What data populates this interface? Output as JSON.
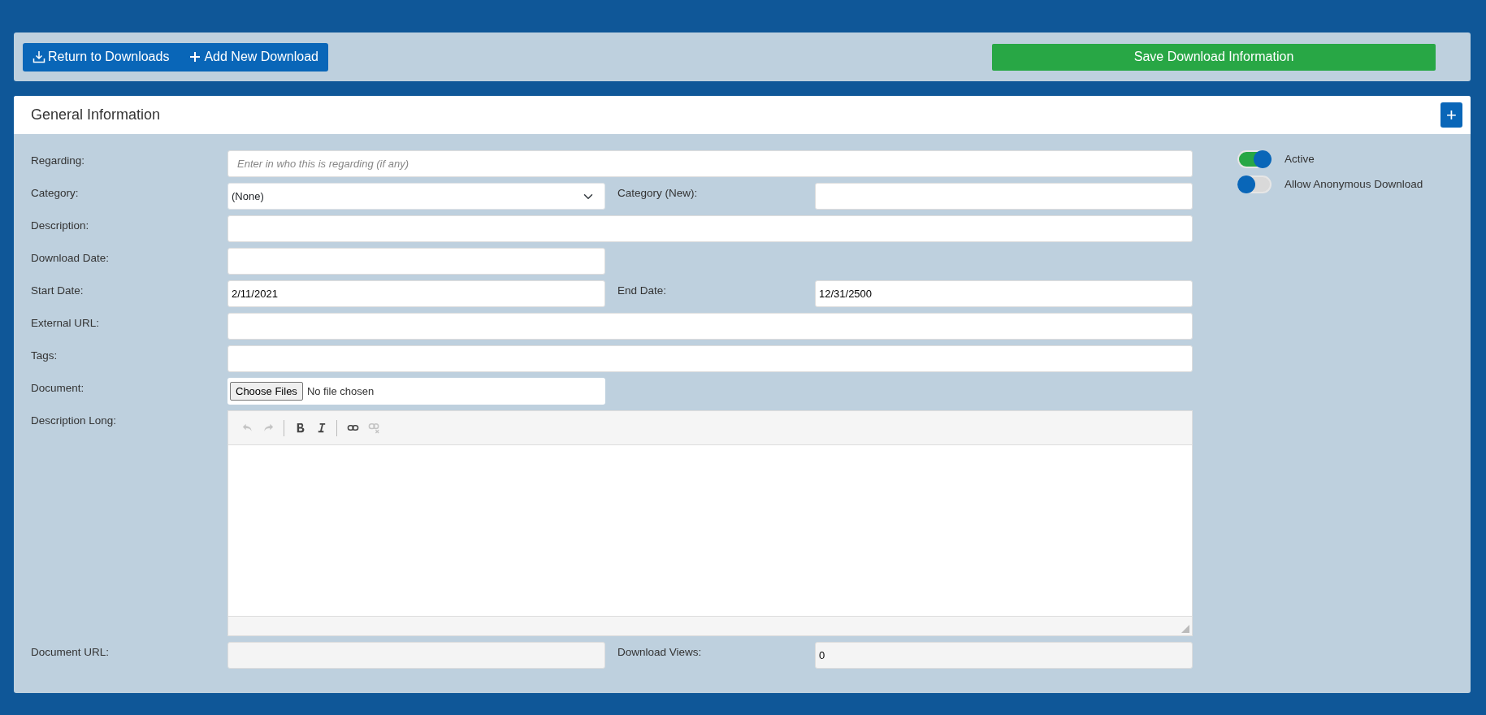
{
  "toolbar": {
    "buttons": [
      {
        "kind": "download",
        "label": "Return to Downloads"
      },
      {
        "kind": "plus",
        "label": "Add New Download"
      }
    ],
    "save": "Save Download Information"
  },
  "card": {
    "title": "General Information",
    "expand_button": "+",
    "rows": [
      {
        "cells": [
          {
            "label": "Regarding:",
            "kind": "text",
            "wide": true,
            "placeholder": "Enter in who this is regarding (if any)"
          }
        ]
      },
      {
        "cells": [
          {
            "label": "Category:",
            "kind": "select",
            "value": "(None)"
          },
          {
            "label": "Category (New):",
            "kind": "text"
          }
        ]
      },
      {
        "cells": [
          {
            "label": "Description:",
            "kind": "text",
            "wide": true
          }
        ]
      },
      {
        "cells": [
          {
            "label": "Download Date:",
            "kind": "text"
          }
        ]
      },
      {
        "cells": [
          {
            "label": "Start Date:",
            "kind": "text",
            "value": "2/11/2021"
          },
          {
            "label": "End Date:",
            "kind": "text",
            "value": "12/31/2500"
          }
        ]
      },
      {
        "cells": [
          {
            "label": "External URL:",
            "kind": "text",
            "wide": true
          }
        ]
      },
      {
        "cells": [
          {
            "label": "Tags:",
            "kind": "text",
            "wide": true
          }
        ]
      },
      {
        "cells": [
          {
            "label": "Document:",
            "kind": "file",
            "button": "Choose Files",
            "value": "No file chosen"
          }
        ]
      },
      {
        "cells": [
          {
            "label": "Description Long:",
            "kind": "editor",
            "wide": true,
            "tools": [
              [
                {
                  "kind": "undo",
                  "disabled": true
                },
                {
                  "kind": "redo",
                  "disabled": true
                }
              ],
              [
                {
                  "kind": "bold",
                  "disabled": false
                },
                {
                  "kind": "italic",
                  "disabled": false
                }
              ],
              [
                {
                  "kind": "link",
                  "disabled": false
                },
                {
                  "kind": "unlink",
                  "disabled": true
                }
              ]
            ]
          }
        ]
      },
      {
        "cells": [
          {
            "label": "Document URL:",
            "kind": "readonly"
          },
          {
            "label": "Download Views:",
            "kind": "readonly",
            "value": "0"
          }
        ]
      }
    ],
    "toggles": [
      {
        "label": "Active",
        "on": true
      },
      {
        "label": "Allow Anonymous Download",
        "on": false
      }
    ]
  }
}
